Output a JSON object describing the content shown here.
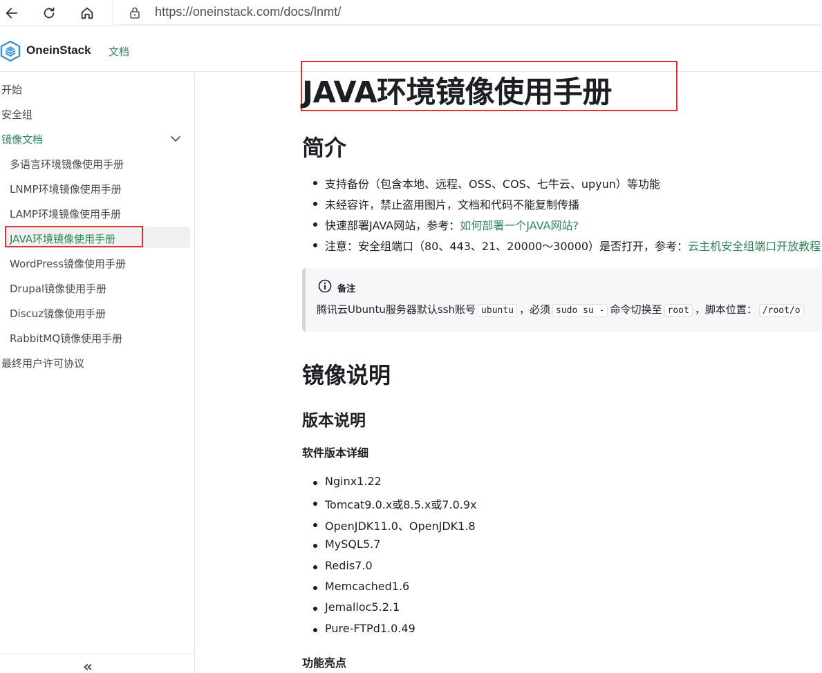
{
  "browser": {
    "url": "https://oneinstack.com/docs/lnmt/"
  },
  "header": {
    "brand": "OneinStack",
    "nav_link": "文档"
  },
  "sidebar": {
    "items": [
      {
        "label": "开始"
      },
      {
        "label": "安全组"
      },
      {
        "label": "镜像文档"
      },
      {
        "label": "多语言环境镜像使用手册"
      },
      {
        "label": "LNMP环境镜像使用手册"
      },
      {
        "label": "LAMP环境镜像使用手册"
      },
      {
        "label": "JAVA环境镜像使用手册"
      },
      {
        "label": "WordPress镜像使用手册"
      },
      {
        "label": "Drupal镜像使用手册"
      },
      {
        "label": "Discuz镜像使用手册"
      },
      {
        "label": "RabbitMQ镜像使用手册"
      },
      {
        "label": "最终用户许可协议"
      }
    ],
    "collapse_glyph": "«"
  },
  "main": {
    "title": "JAVA环境镜像使用手册",
    "intro_heading": "简介",
    "intro_items": [
      {
        "text": "支持备份（包含本地、远程、OSS、COS、七牛云、upyun）等功能"
      },
      {
        "text": "未经容许，禁止盗用图片，文档和代码不能复制传播"
      },
      {
        "text": "快速部署JAVA网站，参考：",
        "link": "如何部署一个JAVA网站?"
      },
      {
        "text": "注意：安全组端口（80、443、21、20000～30000）是否打开，参考：",
        "link": "云主机安全组端口开放教程"
      }
    ],
    "note": {
      "title": "备注",
      "text_1": "腾讯云Ubuntu服务器默认ssh账号",
      "code_1": "ubuntu",
      "text_2": "，必须",
      "code_2": "sudo su -",
      "text_3": "命令切换至",
      "code_3": "root",
      "text_4": "，脚本位置：",
      "code_4": "/root/o"
    },
    "image_heading": "镜像说明",
    "version_heading": "版本说明",
    "software_heading": "软件版本详细",
    "software_items": [
      "Nginx1.22",
      "Tomcat9.0.x或8.5.x或7.0.9x",
      "OpenJDK11.0、OpenJDK1.8",
      "MySQL5.7",
      "Redis7.0",
      "Memcached1.6",
      "Jemalloc5.2.1",
      "Pure-FTPd1.0.49"
    ],
    "features_heading": "功能亮点"
  },
  "colors": {
    "accent": "#2e8555",
    "annotation": "#e03131"
  }
}
